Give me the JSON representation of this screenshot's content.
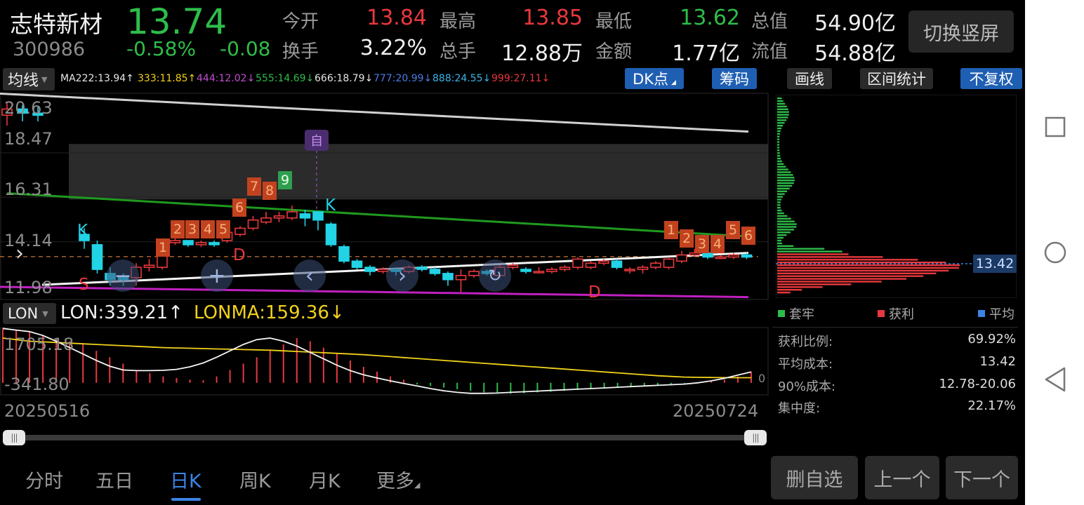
{
  "stock": {
    "name": "志特新材",
    "code": "300986",
    "price": "13.74",
    "change_pct": "-0.58%",
    "change": "-0.08"
  },
  "quote": {
    "open_label": "今开",
    "open": "13.84",
    "high_label": "最高",
    "high": "13.85",
    "low_label": "最低",
    "low": "13.62",
    "mcap_label": "总值",
    "mcap": "54.90亿",
    "turnover_label": "换手",
    "turnover": "3.22%",
    "volume_label": "总手",
    "volume": "12.88万",
    "amount_label": "金额",
    "amount": "1.77亿",
    "float_label": "流值",
    "float": "54.88亿"
  },
  "switch_label": "切换竖屏",
  "indicator_select": "均线",
  "ma_values": [
    {
      "text": "MA222:13.94↑",
      "color": "#e6e6e6"
    },
    {
      "text": "333:11.85↑",
      "color": "#f2d21b"
    },
    {
      "text": "444:12.02↓",
      "color": "#c050d0"
    },
    {
      "text": "555:14.69↓",
      "color": "#2ebd4a"
    },
    {
      "text": "666:18.79↓",
      "color": "#e6e6e6"
    },
    {
      "text": "777:20.99↓",
      "color": "#4a7ce8"
    },
    {
      "text": "888:24.55↓",
      "color": "#38b5e8"
    },
    {
      "text": "999:27.11↓",
      "color": "#e8383d"
    }
  ],
  "chips": {
    "dk": "DK点",
    "chouma": "筹码",
    "huaxian": "画线",
    "qujian": "区间统计",
    "fuquan": "不复权"
  },
  "price_axis": [
    "20.63",
    "18.47",
    "16.31",
    "14.14",
    "11.98"
  ],
  "candle_markers": [
    "K",
    "S",
    "D",
    "自",
    "K",
    "D"
  ],
  "seq_labels": [
    "1",
    "2",
    "3",
    "4",
    "5",
    "6",
    "7",
    "8",
    "9",
    "1",
    "2",
    "3",
    "4",
    "5",
    "6"
  ],
  "lon": {
    "select": "LON",
    "lon_text": "LON:339.21↑",
    "lonma_text": "LONMA:159.36↓",
    "axis_top": "1705.18",
    "axis_bottom": "-341.80",
    "zero_label": "0"
  },
  "dates": {
    "start": "20250516",
    "end": "20250724"
  },
  "chip_panel": {
    "price_tag": "13.42",
    "legend": [
      {
        "label": "套牢",
        "color": "#2ebd4a"
      },
      {
        "label": "获利",
        "color": "#e8383d"
      },
      {
        "label": "平均",
        "color": "#3b84e6"
      }
    ],
    "stats": [
      {
        "label": "获利比例:",
        "value": "69.92%"
      },
      {
        "label": "平均成本:",
        "value": "13.42"
      },
      {
        "label": "90%成本:",
        "value": "12.78-20.06"
      },
      {
        "label": "集中度:",
        "value": "22.17%"
      }
    ]
  },
  "tabs": [
    "分时",
    "五日",
    "日K",
    "周K",
    "月K",
    "更多"
  ],
  "active_tab": "日K",
  "bottom_buttons": [
    "删自选",
    "上一个",
    "下一个"
  ],
  "colors": {
    "up": "#e8383d",
    "down": "#22d3e6",
    "green": "#2ebd4a",
    "accent": "#3b84e6"
  },
  "chart_data": {
    "type": "candlestick",
    "candles": [
      {
        "o": 20.3,
        "c": 20.6,
        "h": 20.9,
        "l": 19.8
      },
      {
        "o": 20.6,
        "c": 20.4,
        "h": 20.8,
        "l": 20.0
      },
      {
        "o": 20.4,
        "c": 20.3,
        "h": 20.7,
        "l": 20.0
      },
      {
        "o": 14.5,
        "c": 14.2,
        "h": 14.8,
        "l": 13.8
      },
      {
        "o": 14.0,
        "c": 12.8,
        "h": 14.2,
        "l": 12.6
      },
      {
        "o": 12.6,
        "c": 12.3,
        "h": 12.9,
        "l": 12.0
      },
      {
        "o": 12.4,
        "c": 12.3,
        "h": 12.6,
        "l": 12.0
      },
      {
        "o": 12.4,
        "c": 12.9,
        "h": 13.1,
        "l": 12.0
      },
      {
        "o": 12.9,
        "c": 13.0,
        "h": 13.3,
        "l": 12.7
      },
      {
        "o": 12.9,
        "c": 14.1,
        "h": 14.2,
        "l": 12.8
      },
      {
        "o": 14.1,
        "c": 14.2,
        "h": 14.3,
        "l": 14.0
      },
      {
        "o": 14.2,
        "c": 14.0,
        "h": 14.2,
        "l": 13.9
      },
      {
        "o": 14.0,
        "c": 14.1,
        "h": 14.2,
        "l": 13.9
      },
      {
        "o": 14.1,
        "c": 14.0,
        "h": 14.2,
        "l": 13.9
      },
      {
        "o": 14.2,
        "c": 14.6,
        "h": 14.8,
        "l": 14.1
      },
      {
        "o": 14.5,
        "c": 14.8,
        "h": 14.9,
        "l": 14.4
      },
      {
        "o": 14.8,
        "c": 15.2,
        "h": 15.4,
        "l": 14.7
      },
      {
        "o": 15.1,
        "c": 15.3,
        "h": 15.6,
        "l": 15.0
      },
      {
        "o": 15.3,
        "c": 15.4,
        "h": 15.6,
        "l": 15.1
      },
      {
        "o": 15.3,
        "c": 15.6,
        "h": 15.9,
        "l": 15.2
      },
      {
        "o": 15.5,
        "c": 15.3,
        "h": 15.7,
        "l": 14.9
      },
      {
        "o": 15.6,
        "c": 15.2,
        "h": 15.6,
        "l": 14.7
      },
      {
        "o": 15.0,
        "c": 14.0,
        "h": 15.1,
        "l": 13.9
      },
      {
        "o": 13.9,
        "c": 13.2,
        "h": 14.0,
        "l": 13.1
      },
      {
        "o": 13.2,
        "c": 12.9,
        "h": 13.3,
        "l": 12.8
      },
      {
        "o": 12.9,
        "c": 12.7,
        "h": 13.0,
        "l": 12.5
      },
      {
        "o": 12.7,
        "c": 12.8,
        "h": 12.9,
        "l": 12.6
      },
      {
        "o": 12.8,
        "c": 12.7,
        "h": 12.9,
        "l": 12.5
      },
      {
        "o": 12.7,
        "c": 12.9,
        "h": 13.0,
        "l": 12.6
      },
      {
        "o": 12.9,
        "c": 12.8,
        "h": 13.0,
        "l": 12.7
      },
      {
        "o": 12.8,
        "c": 12.6,
        "h": 12.9,
        "l": 12.5
      },
      {
        "o": 12.6,
        "c": 12.3,
        "h": 12.7,
        "l": 12.0
      },
      {
        "o": 12.3,
        "c": 12.5,
        "h": 12.8,
        "l": 11.7
      },
      {
        "o": 12.5,
        "c": 12.7,
        "h": 12.8,
        "l": 12.4
      },
      {
        "o": 12.7,
        "c": 12.6,
        "h": 12.8,
        "l": 12.5
      },
      {
        "o": 12.5,
        "c": 12.9,
        "h": 13.0,
        "l": 12.4
      },
      {
        "o": 12.9,
        "c": 13.0,
        "h": 13.1,
        "l": 12.8
      },
      {
        "o": 12.8,
        "c": 12.7,
        "h": 12.9,
        "l": 12.6
      },
      {
        "o": 12.7,
        "c": 12.7,
        "h": 12.9,
        "l": 12.6
      },
      {
        "o": 12.7,
        "c": 12.8,
        "h": 12.9,
        "l": 12.6
      },
      {
        "o": 12.8,
        "c": 12.9,
        "h": 13.0,
        "l": 12.7
      },
      {
        "o": 12.9,
        "c": 13.3,
        "h": 13.4,
        "l": 12.8
      },
      {
        "o": 12.9,
        "c": 13.1,
        "h": 13.2,
        "l": 12.8
      },
      {
        "o": 13.1,
        "c": 13.2,
        "h": 13.3,
        "l": 13.0
      },
      {
        "o": 13.2,
        "c": 12.9,
        "h": 13.3,
        "l": 12.8
      },
      {
        "o": 12.8,
        "c": 12.8,
        "h": 12.9,
        "l": 12.6
      },
      {
        "o": 12.8,
        "c": 12.9,
        "h": 13.0,
        "l": 12.6
      },
      {
        "o": 12.9,
        "c": 13.1,
        "h": 13.2,
        "l": 12.8
      },
      {
        "o": 12.9,
        "c": 13.3,
        "h": 13.4,
        "l": 12.8
      },
      {
        "o": 13.2,
        "c": 13.5,
        "h": 13.7,
        "l": 13.1
      },
      {
        "o": 13.5,
        "c": 13.6,
        "h": 13.8,
        "l": 13.4
      },
      {
        "o": 13.6,
        "c": 13.4,
        "h": 13.7,
        "l": 13.3
      },
      {
        "o": 13.4,
        "c": 13.4,
        "h": 13.5,
        "l": 13.3
      },
      {
        "o": 13.4,
        "c": 13.5,
        "h": 13.6,
        "l": 13.3
      },
      {
        "o": 13.5,
        "c": 13.4,
        "h": 13.6,
        "l": 13.3
      },
      {
        "o": 13.4,
        "c": 13.9,
        "h": 14.0,
        "l": 13.3
      },
      {
        "o": 13.8,
        "c": 13.7,
        "h": 13.9,
        "l": 13.6
      }
    ],
    "lon_bars": [
      1700,
      1650,
      1600,
      1500,
      1400,
      1300,
      1200,
      1000,
      800,
      600,
      400,
      300,
      200,
      150,
      100,
      80,
      200,
      400,
      600,
      800,
      1000,
      1200,
      1400,
      1300,
      1100,
      900,
      700,
      500,
      350,
      200,
      100,
      -50,
      -100,
      -150,
      -200,
      -250,
      -300,
      -320,
      -340,
      -330,
      -300,
      -280,
      -250,
      -220,
      -200,
      -180,
      -150,
      -120,
      -100,
      -80,
      -50,
      -20,
      20,
      60,
      100,
      200,
      339
    ],
    "lon_line": [
      1700,
      1650,
      1600,
      1480,
      1300,
      1100,
      900,
      700,
      520,
      400,
      380,
      380,
      390,
      420,
      500,
      620,
      800,
      1000,
      1200,
      1350,
      1400,
      1300,
      1150,
      950,
      750,
      550,
      380,
      250,
      150,
      60,
      -20,
      -100,
      -180,
      -250,
      -300,
      -330,
      -330,
      -320,
      -300,
      -280,
      -260,
      -240,
      -220,
      -200,
      -180,
      -160,
      -140,
      -120,
      -100,
      -80,
      -60,
      -40,
      0,
      60,
      140,
      240,
      339
    ],
    "lonma_line": [
      1400,
      1350,
      1300,
      1280,
      1260,
      1240,
      1220,
      1200,
      1180,
      1160,
      1140,
      1120,
      1100,
      1090,
      1080,
      1070,
      1060,
      1050,
      1040,
      1030,
      1020,
      1000,
      980,
      960,
      940,
      920,
      900,
      880,
      850,
      820,
      790,
      760,
      730,
      700,
      670,
      640,
      610,
      580,
      550,
      520,
      490,
      460,
      430,
      400,
      370,
      340,
      310,
      280,
      250,
      220,
      200,
      180,
      170,
      165,
      162,
      160,
      159
    ]
  }
}
